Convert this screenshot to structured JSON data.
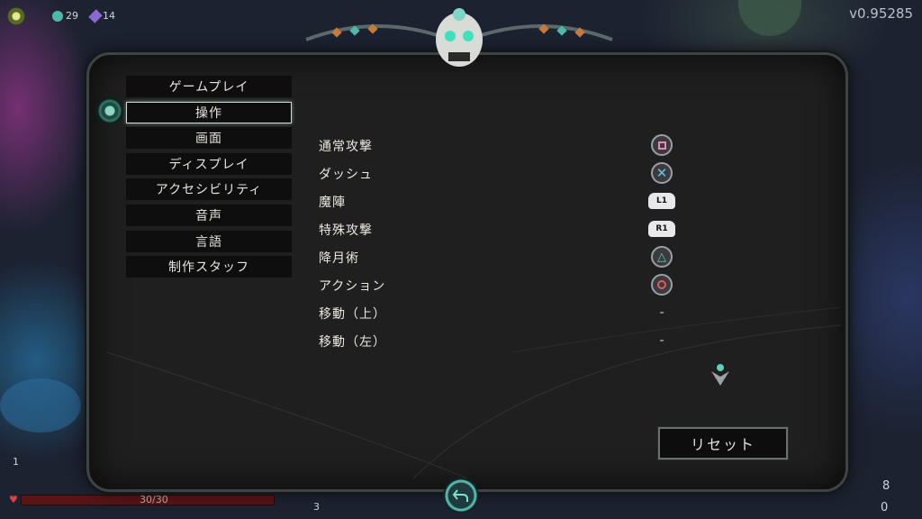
{
  "version": "v0.95285",
  "hud": {
    "currency_a": "29",
    "currency_b": "14",
    "bottom_right_a": "8",
    "bottom_right_b": "0",
    "bottom_left_hp": "30/30",
    "bottom_left_small": "3",
    "bottom_left_level": "1"
  },
  "menu": {
    "items": [
      {
        "label": "ゲームプレイ"
      },
      {
        "label": "操作"
      },
      {
        "label": "画面"
      },
      {
        "label": "ディスプレイ"
      },
      {
        "label": "アクセシビリティ"
      },
      {
        "label": "音声"
      },
      {
        "label": "言語"
      },
      {
        "label": "制作スタッフ"
      }
    ],
    "selected_index": 1
  },
  "controls": [
    {
      "label": "通常攻撃",
      "binding": "square-button-icon"
    },
    {
      "label": "ダッシュ",
      "binding": "cross-button-icon"
    },
    {
      "label": "魔陣",
      "binding": "L1"
    },
    {
      "label": "特殊攻撃",
      "binding": "R1"
    },
    {
      "label": "降月術",
      "binding": "triangle-button-icon"
    },
    {
      "label": "アクション",
      "binding": "circle-button-icon"
    },
    {
      "label": "移動（上）",
      "binding": "-"
    },
    {
      "label": "移動（左）",
      "binding": "-"
    }
  ],
  "reset_label": "リセット",
  "colors": {
    "accent_teal": "#4fb8ad",
    "square": "#e68ab8",
    "cross": "#6cc6e6",
    "triangle": "#5fd0a8",
    "circle": "#e05a5a"
  }
}
